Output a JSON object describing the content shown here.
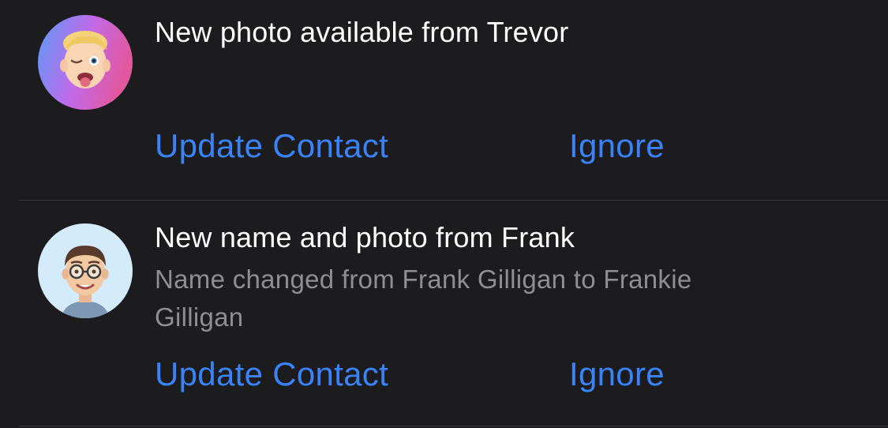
{
  "notifications": [
    {
      "title": "New photo available from Trevor",
      "subtitle": "",
      "avatar_icon": "memoji-trevor-avatar",
      "avatar_colors": [
        "#5b9cf7",
        "#c06ae9",
        "#e2589f"
      ],
      "actions": {
        "update_label": "Update Contact",
        "ignore_label": "Ignore"
      }
    },
    {
      "title": "New name and photo from Frank",
      "subtitle": "Name changed from Frank Gilligan to Frankie Gilligan",
      "avatar_icon": "memoji-frank-avatar",
      "avatar_colors": [
        "#d3ebfb"
      ],
      "actions": {
        "update_label": "Update Contact",
        "ignore_label": "Ignore"
      }
    }
  ],
  "colors": {
    "background": "#1c1c1e",
    "primary_text": "#ffffff",
    "secondary_text": "#8e8e93",
    "accent": "#3a82f7",
    "separator": "#38383a"
  }
}
